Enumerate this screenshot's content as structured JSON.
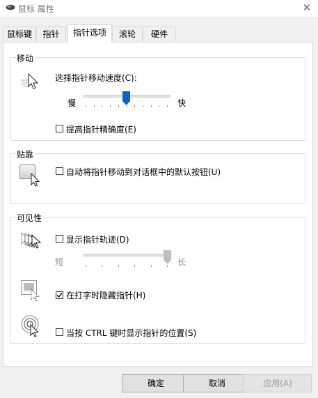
{
  "window": {
    "title": "鼠标 属性",
    "close_glyph": "✕"
  },
  "tabs": [
    {
      "label": "鼠标键",
      "active": false
    },
    {
      "label": "指针",
      "active": false
    },
    {
      "label": "指针选项",
      "active": true
    },
    {
      "label": "滚轮",
      "active": false
    },
    {
      "label": "硬件",
      "active": false
    }
  ],
  "motion": {
    "title": "移动",
    "icon": "pointer-speed-icon",
    "speed_label": "选择指针移动速度(C):",
    "slow_label": "慢",
    "fast_label": "快",
    "speed_level": 0.5,
    "precision_label": "提高指针精确度(E)",
    "precision_checked": false
  },
  "snap": {
    "title": "贴靠",
    "icon": "snap-to-default-button-icon",
    "snap_label": "自动将指针移动到对话框中的默认按钮(U)",
    "snap_checked": false
  },
  "visibility": {
    "title": "可见性",
    "trails_icon": "pointer-trails-icon",
    "trails_label": "显示指针轨迹(D)",
    "trails_checked": false,
    "short_label": "短",
    "long_label": "长",
    "trail_level": 1.0,
    "hide_icon": "hide-pointer-typing-icon",
    "hide_label": "在打字时隐藏指针(H)",
    "hide_checked": true,
    "ctrl_icon": "ctrl-locate-pointer-icon",
    "ctrl_label": "当按 CTRL 键时显示指针的位置(S)",
    "ctrl_checked": false
  },
  "buttons": {
    "ok": "确定",
    "cancel": "取消",
    "apply": "应用(A)"
  },
  "colors": {
    "accent": "#0a64c8",
    "thumb_disabled": "#bfbfbf",
    "check": "#000000"
  }
}
